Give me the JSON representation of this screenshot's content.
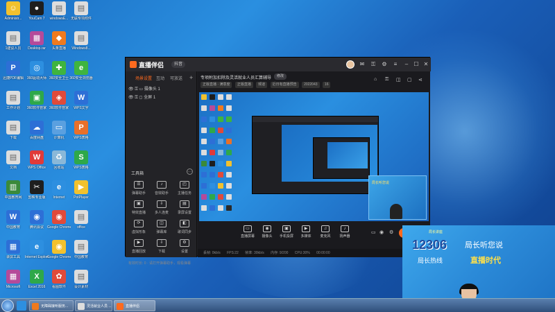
{
  "desktop": {
    "icons": [
      {
        "label": "Administr...",
        "glyph": "☺",
        "color": "#f2c12e"
      },
      {
        "label": "YouCam 7",
        "glyph": "●",
        "color": "#1e1e1e"
      },
      {
        "label": "windowsE...",
        "glyph": "▤",
        "color": "#dddddd"
      },
      {
        "label": "无联专项附件",
        "glyph": "▤",
        "color": "#dddddd"
      },
      {
        "label": "1建议人员",
        "glyph": "▤",
        "color": "#dddddd"
      },
      {
        "label": "Desktop.rar",
        "glyph": "▦",
        "color": "#b54a9a"
      },
      {
        "label": "头条直播",
        "glyph": "◆",
        "color": "#f07a1e"
      },
      {
        "label": "Windows8...",
        "glyph": "▤",
        "color": "#dddddd"
      },
      {
        "label": "迅捷PDF编辑",
        "glyph": "P",
        "color": "#2d6fd6"
      },
      {
        "label": "360驱动大师",
        "glyph": "◎",
        "color": "#2d8fe0"
      },
      {
        "label": "360安全卫士",
        "glyph": "✚",
        "color": "#3fb43f"
      },
      {
        "label": "360安全浏览器",
        "glyph": "e",
        "color": "#3fb43f"
      },
      {
        "label": "工作计划",
        "glyph": "▤",
        "color": "#dddddd"
      },
      {
        "label": "360软件管家",
        "glyph": "▣",
        "color": "#2ea84a"
      },
      {
        "label": "360软件管家",
        "glyph": "◈",
        "color": "#e04a3a"
      },
      {
        "label": "WPS文字",
        "glyph": "W",
        "color": "#2d6fd6"
      },
      {
        "label": "下载",
        "glyph": "▤",
        "color": "#dddddd"
      },
      {
        "label": "百度网盘",
        "glyph": "☁",
        "color": "#2d6fd6"
      },
      {
        "label": "计算机",
        "glyph": "▭",
        "color": "#5aa0e0"
      },
      {
        "label": "WPS表格",
        "glyph": "P",
        "color": "#e8702a"
      },
      {
        "label": "文档",
        "glyph": "▤",
        "color": "#dddddd"
      },
      {
        "label": "WPS Office",
        "glyph": "W",
        "color": "#e03a3a"
      },
      {
        "label": "回收站",
        "glyph": "♻",
        "color": "#8ab8d8"
      },
      {
        "label": "WPS表格",
        "glyph": "S",
        "color": "#2ea84a"
      },
      {
        "label": "中国教育网",
        "glyph": "▥",
        "color": "#3a8a3a"
      },
      {
        "label": "剪映专业版",
        "glyph": "✂",
        "color": "#1e1e1e"
      },
      {
        "label": "Internet",
        "glyph": "e",
        "color": "#2d8fe0"
      },
      {
        "label": "PotPlayer",
        "glyph": "▶",
        "color": "#f2c12e"
      },
      {
        "label": "中国教育",
        "glyph": "W",
        "color": "#2d6fd6"
      },
      {
        "label": "腾讯会议",
        "glyph": "◉",
        "color": "#2d6fd6"
      },
      {
        "label": "Google Chrome",
        "glyph": "◉",
        "color": "#e04a3a"
      },
      {
        "label": "office",
        "glyph": "▤",
        "color": "#dddddd"
      },
      {
        "label": "录屏工具",
        "glyph": "▦",
        "color": "#2d6fd6"
      },
      {
        "label": "Internet Explorer",
        "glyph": "e",
        "color": "#2d8fe0"
      },
      {
        "label": "Google Chrome",
        "glyph": "◉",
        "color": "#f2c12e"
      },
      {
        "label": "中国教育",
        "glyph": "▤",
        "color": "#dddddd"
      },
      {
        "label": "Microsoft",
        "glyph": "▦",
        "color": "#b54a9a"
      },
      {
        "label": "Excel 2016",
        "glyph": "X",
        "color": "#2ea84a"
      },
      {
        "label": "看图软件",
        "glyph": "✿",
        "color": "#e04a3a"
      },
      {
        "label": "设计素材",
        "glyph": "▤",
        "color": "#dddddd"
      },
      {
        "label": "PsiUpVideo...",
        "glyph": "▤",
        "color": "#dddddd"
      },
      {
        "label": "Word 2007",
        "glyph": "W",
        "color": "#2d6fd6"
      },
      {
        "label": "中国教育",
        "glyph": "▤",
        "color": "#dddddd"
      },
      {
        "label": "1.jpg",
        "glyph": "▨",
        "color": "#2a2a2a"
      }
    ]
  },
  "app": {
    "brand": "直播伴侣",
    "brand_badge": "抖音",
    "left_tabs": [
      "场景设置",
      "互动",
      "可放送"
    ],
    "scene_items": [
      "摄像头 1",
      "全屏 1"
    ],
    "tools_title": "工具箱",
    "tools": [
      {
        "icon": "☰",
        "label": "弹幕助手"
      },
      {
        "icon": "♪",
        "label": "音效助手"
      },
      {
        "icon": "◰",
        "label": "主播任务"
      },
      {
        "icon": "▣",
        "label": "特效直播"
      },
      {
        "icon": "⇩",
        "label": "多人连麦"
      },
      {
        "icon": "▤",
        "label": "录屏设置"
      },
      {
        "icon": "⟳",
        "label": "虚拟形象"
      },
      {
        "icon": "◫",
        "label": "弹幕库"
      },
      {
        "icon": "◧",
        "label": "歌词同步"
      },
      {
        "icon": "▶",
        "label": "直播回放"
      },
      {
        "icon": "⇩",
        "label": "下载"
      },
      {
        "icon": "⚙",
        "label": "设置"
      }
    ],
    "center": {
      "title": "专项附加扣除及灵活就业人员汇算辅导",
      "edit_label": "修改",
      "meta": [
        "正版直播 · 满意度",
        "正版直播",
        "频道",
        "近日有直播预告",
        "2022043",
        "16"
      ]
    },
    "controls": [
      {
        "icon": "▭",
        "label": "直播屏幕"
      },
      {
        "icon": "◉",
        "label": "摄像头"
      },
      {
        "icon": "▣",
        "label": "手机投屏"
      },
      {
        "icon": "▶",
        "label": "多媒体"
      },
      {
        "icon": "♫",
        "label": "麦克风"
      },
      {
        "icon": "♪",
        "label": "扬声器"
      }
    ],
    "golive_label": "开始",
    "status": [
      "丢帧: 0kb/s",
      "FPS:22",
      "帧率: 30kb/s",
      "内存: 9/200",
      "CPU:30%",
      "00:00:00"
    ],
    "left_status": "有效时长: 0 · 请打开弹幕助手，观看弹幕"
  },
  "camera": {
    "sub": "局长讲座",
    "num": "12306",
    "t1": "局长听您说",
    "t2": "局长热线",
    "t3": "直播时代"
  },
  "taskbar": {
    "tasks": [
      "无障碍接听服务...",
      "灵活就业人员 ...",
      "直播伴侣"
    ]
  }
}
